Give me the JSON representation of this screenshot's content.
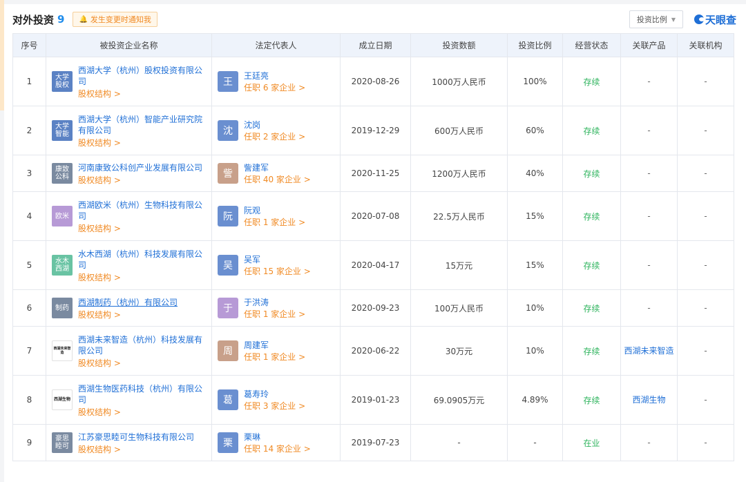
{
  "header": {
    "title": "对外投资",
    "count": "9",
    "notify": "发生变更时通知我",
    "ratio_select": "投资比例",
    "logo": "天眼查"
  },
  "columns": [
    "序号",
    "被投资企业名称",
    "法定代表人",
    "成立日期",
    "投资数额",
    "投资比例",
    "经营状态",
    "关联产品",
    "关联机构"
  ],
  "colors": {
    "link": "#1f6fd6",
    "orange": "#f08a24",
    "status_green": "#2fb45e",
    "header_bg": "#eef3fb"
  },
  "rows": [
    {
      "no": "1",
      "logo": "大学\n股权",
      "logo_color": "#5b82c4",
      "logo_type": "text",
      "company": "西湖大学（杭州）股权投资有限公司",
      "equity": "股权结构",
      "avatar": "王",
      "avatar_color": "#6a8fd0",
      "legal": "王廷亮",
      "job": "任职 6 家企业",
      "date": "2020-08-26",
      "amount": "1000万人民币",
      "ratio": "100%",
      "status": "存续",
      "product": "-",
      "org": "-"
    },
    {
      "no": "2",
      "logo": "大学\n智能",
      "logo_color": "#5b82c4",
      "logo_type": "text",
      "company": "西湖大学（杭州）智能产业研究院有限公司",
      "equity": "股权结构",
      "avatar": "沈",
      "avatar_color": "#6a8fd0",
      "legal": "沈岗",
      "job": "任职 2 家企业",
      "date": "2019-12-29",
      "amount": "600万人民币",
      "ratio": "60%",
      "status": "存续",
      "product": "-",
      "org": "-"
    },
    {
      "no": "3",
      "logo": "康致\n公科",
      "logo_color": "#7a8aa0",
      "logo_type": "text",
      "company": "河南康致公科创产业发展有限公司",
      "equity": "股权结构",
      "avatar": "訾",
      "avatar_color": "#c8a08a",
      "legal": "訾建军",
      "job": "任职 40 家企业",
      "date": "2020-11-25",
      "amount": "1200万人民币",
      "ratio": "40%",
      "status": "存续",
      "product": "-",
      "org": "-"
    },
    {
      "no": "4",
      "logo": "欧米",
      "logo_color": "#b79ad6",
      "logo_type": "text",
      "company": "西湖欧米（杭州）生物科技有限公司",
      "equity": "股权结构",
      "avatar": "阮",
      "avatar_color": "#6a8fd0",
      "legal": "阮观",
      "job": "任职 1 家企业",
      "date": "2020-07-08",
      "amount": "22.5万人民币",
      "ratio": "15%",
      "status": "存续",
      "product": "-",
      "org": "-"
    },
    {
      "no": "5",
      "logo": "水木\n西湖",
      "logo_color": "#69c3a3",
      "logo_type": "text",
      "company": "水木西湖（杭州）科技发展有限公司",
      "equity": "股权结构",
      "avatar": "吴",
      "avatar_color": "#6a8fd0",
      "legal": "吴军",
      "job": "任职 15 家企业",
      "date": "2020-04-17",
      "amount": "15万元",
      "ratio": "15%",
      "status": "存续",
      "product": "-",
      "org": "-"
    },
    {
      "no": "6",
      "logo": "制药",
      "logo_color": "#7a8aa0",
      "logo_type": "text",
      "company": "西湖制药（杭州）有限公司",
      "equity": "股权结构",
      "avatar": "于",
      "avatar_color": "#b79ad6",
      "legal": "于洪涛",
      "job": "任职 1 家企业",
      "date": "2020-09-23",
      "amount": "100万人民币",
      "ratio": "10%",
      "status": "存续",
      "product": "-",
      "org": "-"
    },
    {
      "no": "7",
      "logo": "西湖未来智造",
      "logo_color": "#ffffff",
      "logo_type": "img",
      "company": "西湖未来智造（杭州）科技发展有限公司",
      "equity": "股权结构",
      "avatar": "周",
      "avatar_color": "#c8a08a",
      "legal": "周建军",
      "job": "任职 1 家企业",
      "date": "2020-06-22",
      "amount": "30万元",
      "ratio": "10%",
      "status": "存续",
      "product": "西湖未来智造",
      "org": "-"
    },
    {
      "no": "8",
      "logo": "西湖生物",
      "logo_color": "#ffffff",
      "logo_type": "img-bold",
      "company": "西湖生物医药科技（杭州）有限公司",
      "equity": "股权结构",
      "avatar": "葛",
      "avatar_color": "#6a8fd0",
      "legal": "葛寿玲",
      "job": "任职 3 家企业",
      "date": "2019-01-23",
      "amount": "69.0905万元",
      "ratio": "4.89%",
      "status": "存续",
      "product": "西湖生物",
      "org": "-"
    },
    {
      "no": "9",
      "logo": "豪思\n睦可",
      "logo_color": "#7a8aa0",
      "logo_type": "text",
      "company": "江苏豪思睦可生物科技有限公司",
      "equity": "股权结构",
      "avatar": "栗",
      "avatar_color": "#6a8fd0",
      "legal": "栗琳",
      "job": "任职 14 家企业",
      "date": "2019-07-23",
      "amount": "-",
      "ratio": "-",
      "status": "在业",
      "product": "-",
      "org": "-"
    }
  ]
}
